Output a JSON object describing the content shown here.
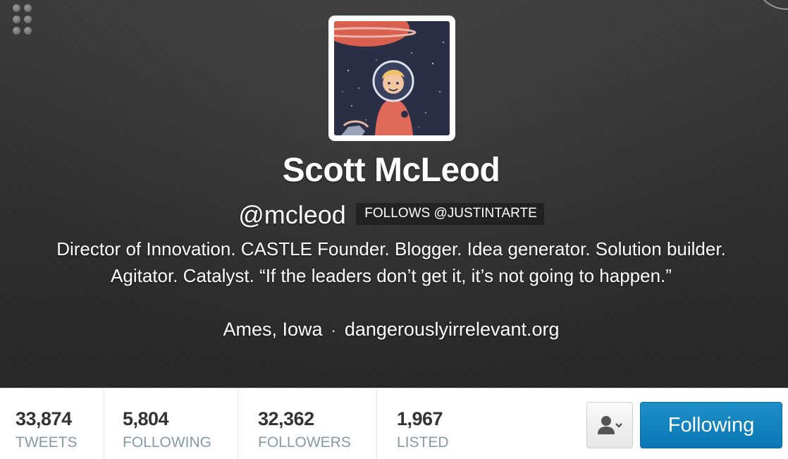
{
  "profile": {
    "name": "Scott McLeod",
    "handle": "@mcleod",
    "follows_badge": "FOLLOWS @JUSTINTARTE",
    "bio": "Director of Innovation. CASTLE Founder. Blogger. Idea generator. Solution builder. Agitator. Catalyst. “If the leaders don’t get it, it’s not going to happen.”",
    "location": "Ames, Iowa",
    "separator": "·",
    "website": "dangerouslyirrelevant.org"
  },
  "stats": [
    {
      "value": "33,874",
      "label": "TWEETS"
    },
    {
      "value": "5,804",
      "label": "FOLLOWING"
    },
    {
      "value": "32,362",
      "label": "FOLLOWERS"
    },
    {
      "value": "1,967",
      "label": "LISTED"
    }
  ],
  "actions": {
    "user_actions_icon": "person-dropdown-icon",
    "follow_label": "Following"
  },
  "colors": {
    "header_bg": "#2e2e2e",
    "follow_button": "#1286c1",
    "stat_label": "#8899a6",
    "stat_value": "#333333"
  }
}
